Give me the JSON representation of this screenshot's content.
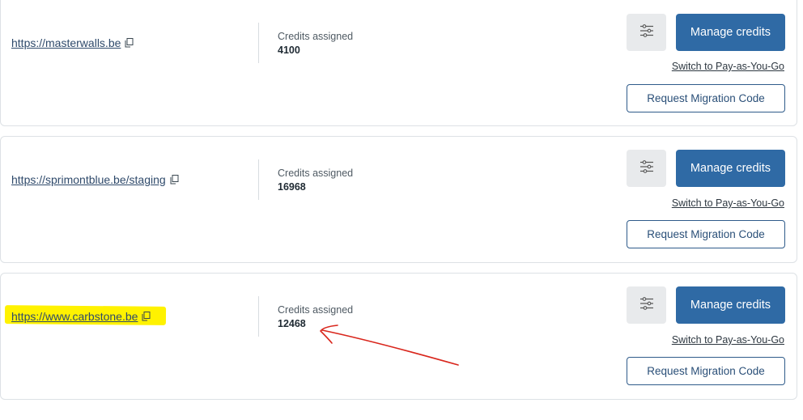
{
  "accounts": [
    {
      "site": "https://masterwalls.be",
      "credits_label": "Credits assigned",
      "credits_value": "4100",
      "manage_label": "Manage credits",
      "payg_label": "Switch to Pay-as-You-Go",
      "migration_label": "Request Migration Code"
    },
    {
      "site": "https://sprimontblue.be/staging",
      "credits_label": "Credits assigned",
      "credits_value": "16968",
      "manage_label": "Manage credits",
      "payg_label": "Switch to Pay-as-You-Go",
      "migration_label": "Request Migration Code"
    },
    {
      "site": "https://www.carbstone.be",
      "credits_label": "Credits assigned",
      "credits_value": "12468",
      "manage_label": "Manage credits",
      "payg_label": "Switch to Pay-as-You-Go",
      "migration_label": "Request Migration Code"
    }
  ],
  "icons": {
    "copy": "copy-icon",
    "settings": "sliders-icon"
  },
  "colors": {
    "primary": "#2f6aa5",
    "highlight": "#fff200",
    "annotation": "#d9261c"
  }
}
